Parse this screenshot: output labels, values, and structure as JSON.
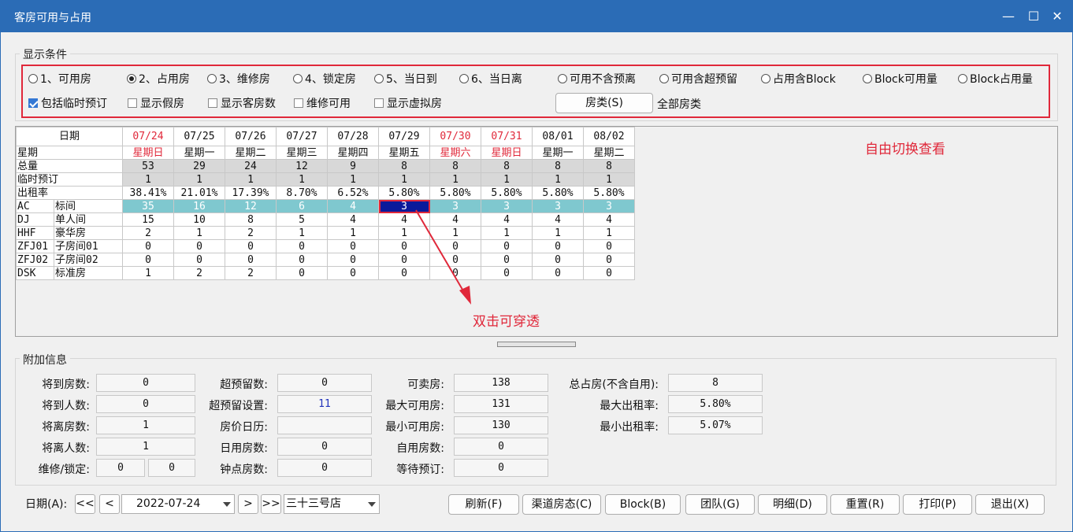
{
  "window": {
    "title": "客房可用与占用",
    "min": "—",
    "max": "☐",
    "close": "✕"
  },
  "conditions": {
    "title": "显示条件",
    "radios": [
      {
        "label": "1、可用房",
        "checked": false
      },
      {
        "label": "2、占用房",
        "checked": true
      },
      {
        "label": "3、维修房",
        "checked": false
      },
      {
        "label": "4、锁定房",
        "checked": false
      },
      {
        "label": "5、当日到",
        "checked": false
      },
      {
        "label": "6、当日离",
        "checked": false
      },
      {
        "label": "可用不含预离",
        "checked": false
      },
      {
        "label": "可用含超预留",
        "checked": false
      },
      {
        "label": "占用含Block",
        "checked": false
      },
      {
        "label": "Block可用量",
        "checked": false
      },
      {
        "label": "Block占用量",
        "checked": false
      }
    ],
    "checks": [
      {
        "label": "包括临时预订",
        "checked": true
      },
      {
        "label": "显示假房",
        "checked": false
      },
      {
        "label": "显示客房数",
        "checked": false
      },
      {
        "label": "维修可用",
        "checked": false
      },
      {
        "label": "显示虚拟房",
        "checked": false
      }
    ],
    "roomtype_button": "房类(S)",
    "roomtype_value": "全部房类"
  },
  "grid": {
    "date_header": "日期",
    "dates": [
      "07/24",
      "07/25",
      "07/26",
      "07/27",
      "07/28",
      "07/29",
      "07/30",
      "07/31",
      "08/01",
      "08/02"
    ],
    "weekdays": [
      "星期日",
      "星期一",
      "星期二",
      "星期三",
      "星期四",
      "星期五",
      "星期六",
      "星期日",
      "星期一",
      "星期二"
    ],
    "red_columns": [
      0,
      6,
      7
    ],
    "summary_rows": [
      {
        "label": "星期"
      },
      {
        "label": "总量",
        "values": [
          "53",
          "29",
          "24",
          "12",
          "9",
          "8",
          "8",
          "8",
          "8",
          "8"
        ]
      },
      {
        "label": "临时预订",
        "values": [
          "1",
          "1",
          "1",
          "1",
          "1",
          "1",
          "1",
          "1",
          "1",
          "1"
        ]
      },
      {
        "label": "出租率",
        "values": [
          "38.41%",
          "21.01%",
          "17.39%",
          "8.70%",
          "6.52%",
          "5.80%",
          "5.80%",
          "5.80%",
          "5.80%",
          "5.80%"
        ]
      }
    ],
    "room_rows": [
      {
        "code": "AC",
        "name": "标间",
        "values": [
          "35",
          "16",
          "12",
          "6",
          "4",
          "3",
          "3",
          "3",
          "3",
          "3"
        ]
      },
      {
        "code": "DJ",
        "name": "单人间",
        "values": [
          "15",
          "10",
          "8",
          "5",
          "4",
          "4",
          "4",
          "4",
          "4",
          "4"
        ]
      },
      {
        "code": "HHF",
        "name": "豪华房",
        "values": [
          "2",
          "1",
          "2",
          "1",
          "1",
          "1",
          "1",
          "1",
          "1",
          "1"
        ]
      },
      {
        "code": "ZFJ01",
        "name": "子房间01",
        "values": [
          "0",
          "0",
          "0",
          "0",
          "0",
          "0",
          "0",
          "0",
          "0",
          "0"
        ]
      },
      {
        "code": "ZFJ02",
        "name": "子房间02",
        "values": [
          "0",
          "0",
          "0",
          "0",
          "0",
          "0",
          "0",
          "0",
          "0",
          "0"
        ]
      },
      {
        "code": "DSK",
        "name": "标准房",
        "values": [
          "1",
          "2",
          "2",
          "0",
          "0",
          "0",
          "0",
          "0",
          "0",
          "0"
        ]
      }
    ],
    "annotation_switch": "自由切换查看",
    "annotation_drill": "双击可穿透"
  },
  "extra": {
    "title": "附加信息",
    "col1": [
      {
        "label": "将到房数:",
        "value": "0"
      },
      {
        "label": "将到人数:",
        "value": "0"
      },
      {
        "label": "将离房数:",
        "value": "1"
      },
      {
        "label": "将离人数:",
        "value": "1"
      }
    ],
    "repair_lock": {
      "label": "维修/锁定:",
      "repair": "0",
      "lock": "0"
    },
    "col2": [
      {
        "label": "超预留数:",
        "value": "0"
      },
      {
        "label": "超预留设置:",
        "value": "11"
      },
      {
        "label": "房价日历:",
        "value": ""
      },
      {
        "label": "日用房数:",
        "value": "0"
      },
      {
        "label": "钟点房数:",
        "value": "0"
      }
    ],
    "col3": [
      {
        "label": "可卖房:",
        "value": "138"
      },
      {
        "label": "最大可用房:",
        "value": "131"
      },
      {
        "label": "最小可用房:",
        "value": "130"
      },
      {
        "label": "自用房数:",
        "value": "0"
      },
      {
        "label": "等待预订:",
        "value": "0"
      }
    ],
    "col4": [
      {
        "label": "总占房(不含自用):",
        "value": "8"
      },
      {
        "label": "最大出租率:",
        "value": "5.80%"
      },
      {
        "label": "最小出租率:",
        "value": "5.07%"
      }
    ]
  },
  "bottom": {
    "date_label": "日期(A):",
    "nav_first": "<<",
    "nav_prev": "<",
    "date_value": "2022-07-24",
    "nav_next": ">",
    "nav_last": ">>",
    "hotel": "三十三号店",
    "buttons": [
      "刷新(F)",
      "渠道房态(C)",
      "Block(B)",
      "团队(G)",
      "明细(D)",
      "重置(R)",
      "打印(P)",
      "退出(X)"
    ]
  },
  "colors": {
    "title_bar": "#2b6cb6",
    "highlight_red": "#e0283a",
    "row_cyan": "#7fc8cf",
    "selected_cell": "#0a1a9b"
  }
}
